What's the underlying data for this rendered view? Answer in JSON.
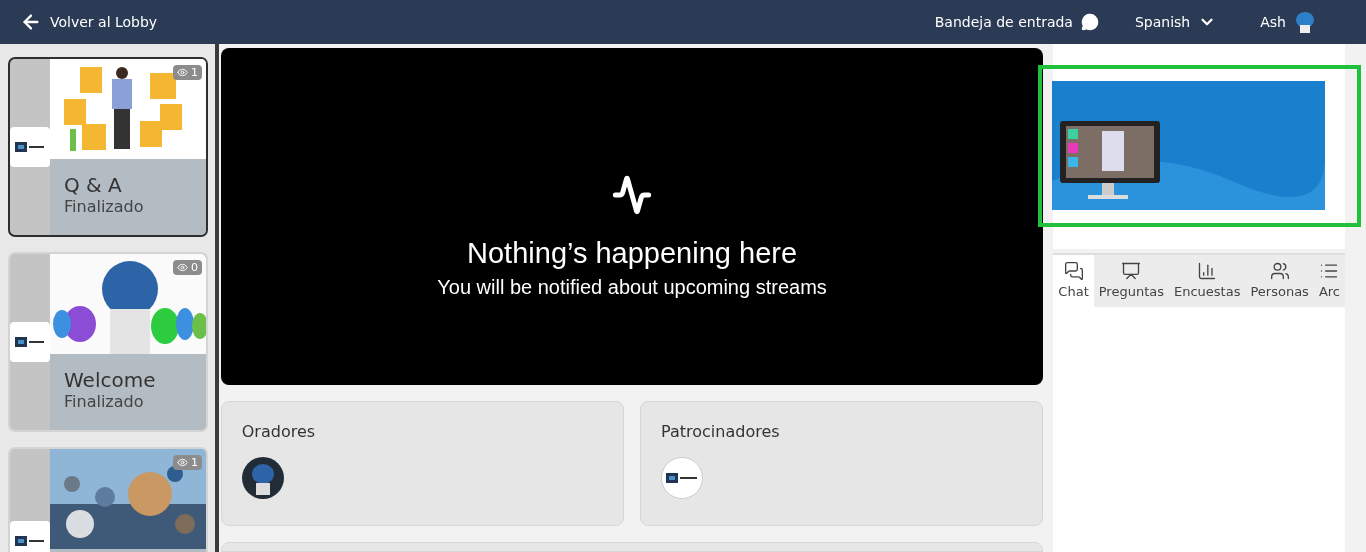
{
  "header": {
    "back_label": "Volver al Lobby",
    "inbox_label": "Bandeja de entrada",
    "language": "Spanish",
    "user": "Ash"
  },
  "sessions": [
    {
      "title": "Q & A",
      "status": "Finalizado",
      "views": "1",
      "selected": true
    },
    {
      "title": "Welcome",
      "status": "Finalizado",
      "views": "0",
      "selected": false
    },
    {
      "views": "1",
      "selected": false
    }
  ],
  "stream": {
    "title": "Nothing’s happening here",
    "subtitle": "You will be notified about upcoming streams"
  },
  "cards": [
    {
      "title": "Oradores",
      "kind": "speaker"
    },
    {
      "title": "Patrocinadores",
      "kind": "sponsor"
    }
  ],
  "banner": {
    "kind": "picture",
    "highlighted": true
  },
  "tabs": [
    {
      "label": "Chat",
      "selected": true
    },
    {
      "label": "Preguntas",
      "selected": false
    },
    {
      "label": "Encuestas",
      "selected": false
    },
    {
      "label": "Personas",
      "selected": false
    },
    {
      "label": "Arc",
      "selected": false
    }
  ]
}
